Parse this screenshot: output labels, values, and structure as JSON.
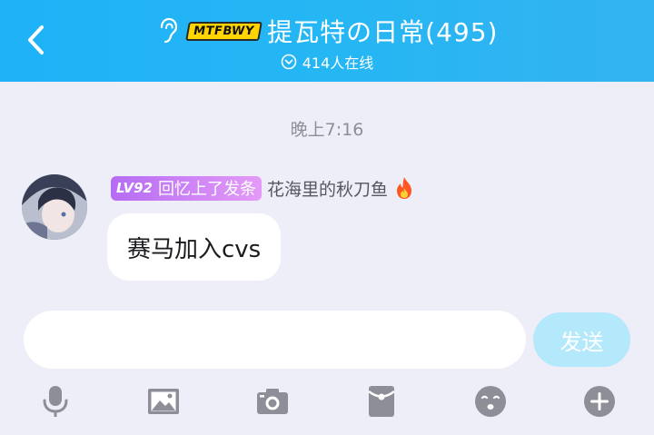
{
  "header": {
    "badge": "MTFBWY",
    "title": "提瓦特の日常(495)",
    "online": "414人在线"
  },
  "chat": {
    "timestamp": "晚上7:16",
    "message": {
      "level": "LV92",
      "title_tag": "回忆上了发条",
      "nickname": "花海里的秋刀鱼",
      "text": "赛马加入cvs"
    }
  },
  "composer": {
    "input_value": "",
    "send_label": "发送"
  },
  "colors": {
    "header": "#25b6f4",
    "send_button": "#b4e8fb",
    "level_tag": "#c47ef6",
    "icon_gray": "#8d8e98"
  },
  "toolbar": [
    "microphone-icon",
    "image-icon",
    "camera-icon",
    "red-packet-icon",
    "emoji-icon",
    "plus-icon"
  ]
}
